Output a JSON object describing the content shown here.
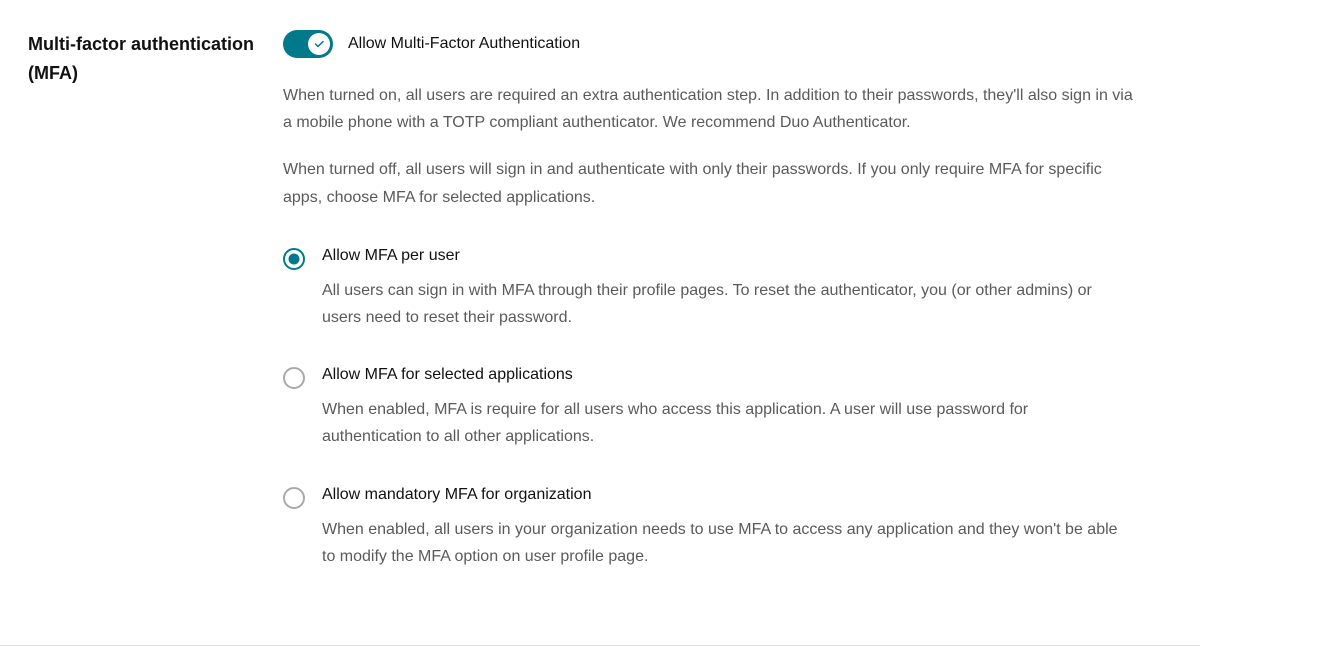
{
  "section": {
    "title": "Multi-factor authentication (MFA)"
  },
  "mfa": {
    "toggle_label": "Allow Multi-Factor Authentication",
    "para1": "When turned on, all users are required an extra authentication step. In addition to their passwords, they'll also sign in via a mobile phone with a TOTP compliant authenticator. We recommend Duo Authenticator.",
    "para2": "When turned off, all users will sign in and authenticate with only their passwords. If you only require MFA for specific apps, choose MFA for selected applications.",
    "options": [
      {
        "label": "Allow MFA per user",
        "desc": "All users can sign in with MFA through their profile pages. To reset the authenticator, you (or other admins) or users need to reset their password."
      },
      {
        "label": "Allow MFA for selected applications",
        "desc": "When enabled, MFA is require for all users who access this application. A user will use password for authentication to all other applications."
      },
      {
        "label": "Allow mandatory MFA for organization",
        "desc": "When enabled, all users in your organization needs to use MFA to access any application and they won't be able to modify the MFA option on user profile page."
      }
    ]
  },
  "colors": {
    "accent": "#007a8a"
  }
}
